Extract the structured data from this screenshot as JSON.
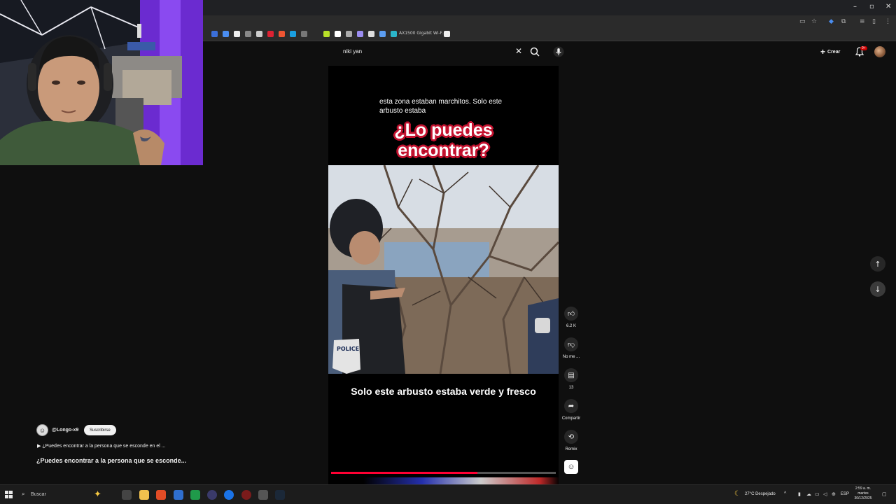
{
  "browser": {
    "bookmark_label": "AX1500 Gigabit Wi-F..."
  },
  "youtube": {
    "search": {
      "value": "niki yan"
    },
    "header": {
      "create_label": "Crear",
      "notification_count": "9+"
    }
  },
  "short": {
    "caption_top": "esta zona estaban marchitos. Solo este arbusto estaba",
    "headline_line1": "¿Lo puedes",
    "headline_line2": "encontrar?",
    "bottom_caption": "Solo este arbusto estaba verde y fresco",
    "progress": 0.65,
    "actions": {
      "like_count": "6.2 K",
      "dislike_label": "No me ...",
      "comments_count": "13",
      "share_label": "Compartir",
      "remix_label": "Remix"
    },
    "channel": {
      "name": "@Longo-x9",
      "subscribe_label": "Suscribirse"
    },
    "description": "▶ ¿Puedes encontrar a la persona que se esconde en el ...",
    "title": "¿Puedes encontrar a la persona que se esconde..."
  },
  "taskbar": {
    "search_label": "Buscar",
    "weather": "27°C  Despejado",
    "language": "ESP",
    "time": "2:59 a. m.",
    "day": "martes",
    "date": "30/12/2025"
  },
  "colors": {
    "youtube_bg": "#0f0f0f",
    "headline_outline": "#c4122f",
    "progress_red": "#ff0033",
    "chrome_bg": "#202124"
  }
}
